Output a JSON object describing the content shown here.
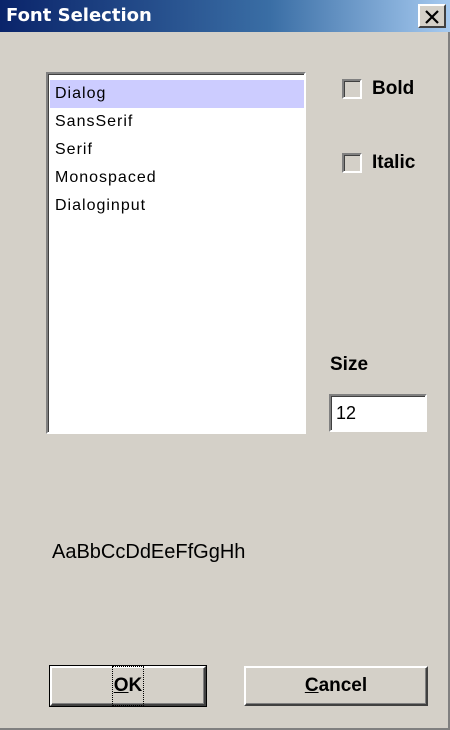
{
  "window": {
    "title": "Font Selection"
  },
  "font_list": {
    "items": [
      {
        "label": "Dialog",
        "selected": true
      },
      {
        "label": "SansSerif",
        "selected": false
      },
      {
        "label": "Serif",
        "selected": false
      },
      {
        "label": "Monospaced",
        "selected": false
      },
      {
        "label": "Dialoginput",
        "selected": false
      }
    ]
  },
  "options": {
    "bold_label": "Bold",
    "bold_checked": false,
    "italic_label": "Italic",
    "italic_checked": false
  },
  "size": {
    "label": "Size",
    "value": "12"
  },
  "preview": {
    "text": "AaBbCcDdEeFfGgHh"
  },
  "buttons": {
    "ok_mnemonic": "O",
    "ok_rest": "K",
    "cancel_mnemonic": "C",
    "cancel_rest": "ancel"
  },
  "icons": {
    "close": "close-icon"
  },
  "colors": {
    "dialog_background": "#d4d0c8",
    "title_bar_start": "#0a246a",
    "title_bar_end": "#a6caf0",
    "selection_highlight": "#ccccff"
  }
}
